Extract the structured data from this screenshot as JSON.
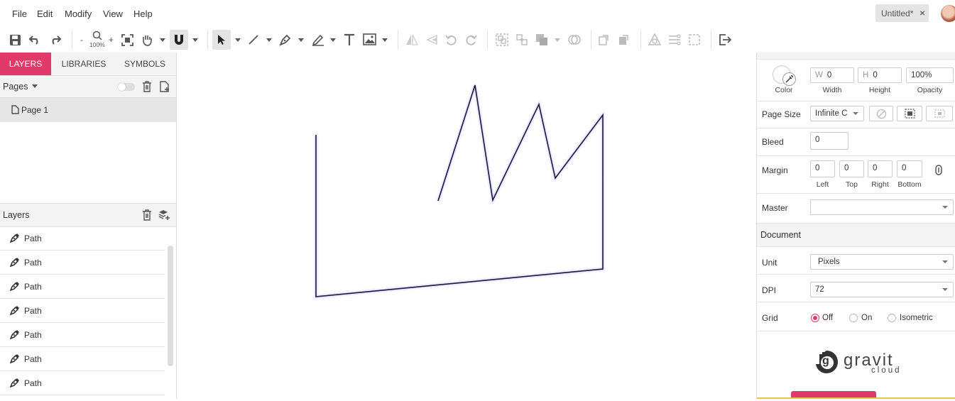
{
  "menu": [
    "File",
    "Edit",
    "Modify",
    "View",
    "Help"
  ],
  "document_tab": {
    "title": "Untitled*",
    "close": "×"
  },
  "toolbar": {
    "zoom_out": "-",
    "zoom_level": "100%",
    "zoom_in": "+"
  },
  "left_panel": {
    "tabs": [
      "LAYERS",
      "LIBRARIES",
      "SYMBOLS"
    ],
    "pages_label": "Pages",
    "pages": [
      "Page 1"
    ],
    "layers_label": "Layers",
    "layers": [
      "Path",
      "Path",
      "Path",
      "Path",
      "Path",
      "Path",
      "Path"
    ]
  },
  "right_panel": {
    "color_label": "Color",
    "width_prefix": "W",
    "width_value": "0",
    "width_label": "Width",
    "height_prefix": "H",
    "height_value": "0",
    "height_label": "Height",
    "opacity_value": "100%",
    "opacity_label": "Opacity",
    "page_size_label": "Page Size",
    "page_size_value": "Infinite C",
    "bleed_label": "Bleed",
    "bleed_value": "0",
    "margin_label": "Margin",
    "margins": [
      {
        "value": "0",
        "label": "Left"
      },
      {
        "value": "0",
        "label": "Top"
      },
      {
        "value": "0",
        "label": "Right"
      },
      {
        "value": "0",
        "label": "Bottom"
      }
    ],
    "master_label": "Master",
    "master_value": "",
    "document_section": "Document",
    "unit_label": "Unit",
    "unit_value": "Pixels",
    "dpi_label": "DPI",
    "dpi_value": "72",
    "grid_label": "Grid",
    "grid_options": [
      "Off",
      "On",
      "Isometric"
    ],
    "grid_selected": "Off",
    "brand_line1": "gravit",
    "brand_line2": "cloud",
    "brand_mark": "g"
  },
  "colors": {
    "accent": "#e03a6b",
    "path_stroke": "#1a1a3a"
  }
}
